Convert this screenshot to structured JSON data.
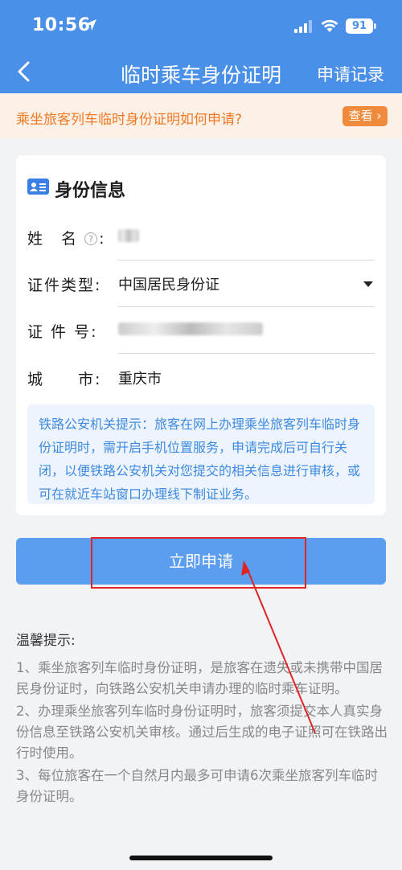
{
  "status_bar": {
    "time": "10:56",
    "battery": "91"
  },
  "nav": {
    "title": "临时乘车身份证明",
    "right_label": "申请记录"
  },
  "banner": {
    "text": "乘坐旅客列车临时身份证明如何申请?",
    "button": "查看"
  },
  "card": {
    "title": "身份信息",
    "fields": [
      {
        "label": "姓　名",
        "value": ""
      },
      {
        "label": "证件类型:",
        "value": "中国居民身份证"
      },
      {
        "label": "证 件 号:",
        "value": ""
      },
      {
        "label": "城　　市:",
        "value": "重庆市"
      }
    ],
    "name_colon": ":",
    "tip": "铁路公安机关提示：旅客在网上办理乘坐旅客列车临时身份证明时，需开启手机位置服务，申请完成后可自行关闭，以便铁路公安机关对您提交的相关信息进行审核，或可在就近车站窗口办理线下制证业务。"
  },
  "submit_label": "立即申请",
  "notes": {
    "title": "温馨提示:",
    "items": [
      "1、乘坐旅客列车临时身份证明，是旅客在遗失或未携带中国居民身份证时，向铁路公安机关申请办理的临时乘车证明。",
      "2、办理乘坐旅客列车临时身份证明时，旅客须提交本人真实身份信息至铁路公安机关审核。通过后生成的电子证照可在铁路出行时使用。",
      "3、每位旅客在一个自然月内最多可申请6次乘坐旅客列车临时身份证明。"
    ]
  },
  "colors": {
    "primary": "#4a90e8",
    "button": "#5b9ef0",
    "banner_text": "#f07a26",
    "annotation": "#e02424"
  },
  "icons": [
    "location-arrow-icon",
    "signal-icon",
    "wifi-icon",
    "battery-icon",
    "back-chevron-icon",
    "id-card-icon",
    "help-icon",
    "dropdown-caret-icon"
  ]
}
